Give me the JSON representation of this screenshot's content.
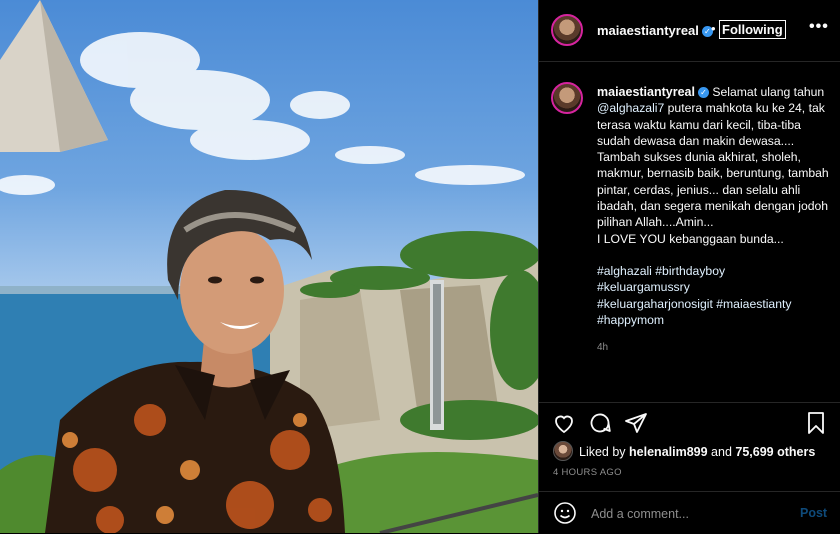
{
  "post": {
    "username": "maiaestiantyreal",
    "follow_state": "Following",
    "separator": "•",
    "more_label": "•••"
  },
  "caption": {
    "username": "maiaestiantyreal",
    "text_before_mention": "Selamat ulang tahun ",
    "mention": "@alghazali7",
    "text_after_mention": " putera mahkota ku ke 24, tak terasa waktu kamu dari kecil, tiba-tiba sudah dewasa dan makin dewasa....\nTambah sukses dunia akhirat, sholeh, makmur, bernasib baik, beruntung, tambah pintar, cerdas, jenius... dan selalu ahli ibadah, dan segera menikah dengan jodoh pilihan Allah....Amin...\nI LOVE YOU kebanggaan bunda...",
    "hashtags": [
      "#alghazali",
      "#birthdayboy",
      "#keluargamussry",
      "#keluargaharjonosigit",
      "#maiaestianty",
      "#happymom"
    ],
    "time": "4h"
  },
  "likes": {
    "prefix": "Liked by",
    "liker": "helenalim899",
    "connector": "and",
    "others": "75,699 others"
  },
  "post_age": "4 HOURS AGO",
  "comment": {
    "placeholder": "Add a comment...",
    "post_label": "Post"
  },
  "colors": {
    "verified": "#3897f0",
    "link": "#e0f1ff",
    "post_disabled": "#0e4a7a",
    "muted": "#8e8e8e"
  },
  "icons": [
    "verified-badge-icon",
    "heart-icon",
    "comment-icon",
    "share-icon",
    "bookmark-icon",
    "emoji-icon",
    "more-options-icon"
  ]
}
